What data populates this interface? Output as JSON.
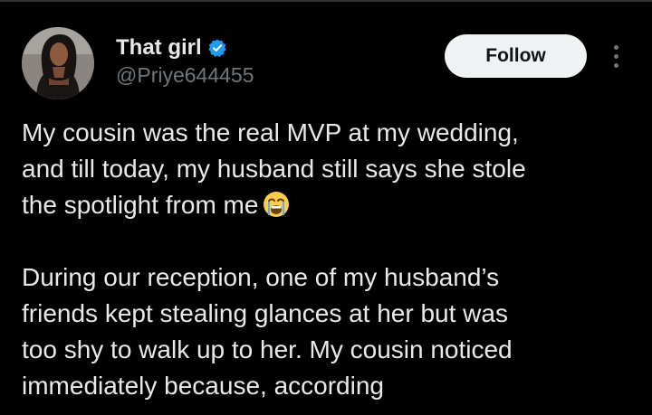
{
  "colors": {
    "background": "#000000",
    "primary_text": "#e7e9ea",
    "secondary_text": "#71767b",
    "verified_blue": "#1d9bf0",
    "follow_button_bg": "#eff3f4",
    "follow_button_text": "#0f1419"
  },
  "author": {
    "display_name": "That girl",
    "handle": "@Priye644455",
    "verified": true,
    "verified_icon": "verified-badge-icon",
    "avatar": "profile-photo"
  },
  "actions": {
    "follow_label": "Follow",
    "more_icon": "more-options-icon"
  },
  "tweet": {
    "paragraph_1": "My cousin was the real MVP at my wedding,\nand till today, my husband still says she stole\nthe spotlight from me",
    "paragraph_1_emoji": "loudly-crying-face-icon",
    "paragraph_2": "During our reception, one of my husband’s\nfriends kept stealing glances at her but was\ntoo shy to walk up to her. My cousin noticed\nimmediately because, according"
  }
}
